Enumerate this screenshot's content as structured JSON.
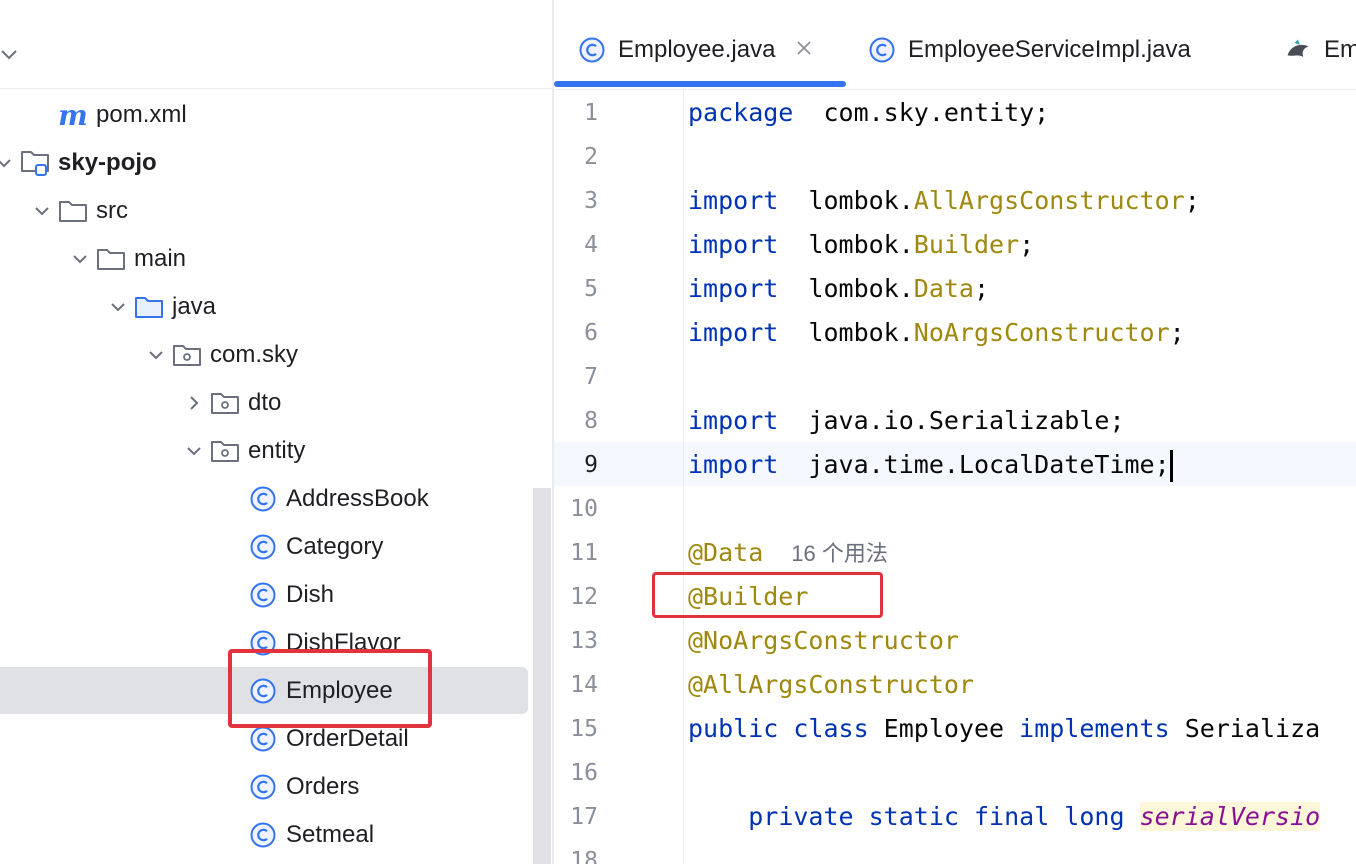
{
  "project_tree": {
    "nodes": [
      {
        "label": "pom.xml",
        "icon": "maven-m-icon",
        "arrow": "none"
      },
      {
        "label": "sky-pojo",
        "icon": "module-folder-icon",
        "arrow": "expanded"
      },
      {
        "label": "src",
        "icon": "folder-icon",
        "arrow": "expanded"
      },
      {
        "label": "main",
        "icon": "folder-icon",
        "arrow": "expanded"
      },
      {
        "label": "java",
        "icon": "source-folder-icon",
        "arrow": "expanded"
      },
      {
        "label": "com.sky",
        "icon": "package-icon",
        "arrow": "expanded"
      },
      {
        "label": "dto",
        "icon": "package-icon",
        "arrow": "collapsed"
      },
      {
        "label": "entity",
        "icon": "package-icon",
        "arrow": "expanded"
      },
      {
        "label": "AddressBook",
        "icon": "class-icon",
        "arrow": "none"
      },
      {
        "label": "Category",
        "icon": "class-icon",
        "arrow": "none"
      },
      {
        "label": "Dish",
        "icon": "class-icon",
        "arrow": "none"
      },
      {
        "label": "DishFlavor",
        "icon": "class-icon",
        "arrow": "none"
      },
      {
        "label": "Employee",
        "icon": "class-icon",
        "arrow": "none",
        "selected": true
      },
      {
        "label": "OrderDetail",
        "icon": "class-icon",
        "arrow": "none"
      },
      {
        "label": "Orders",
        "icon": "class-icon",
        "arrow": "none"
      },
      {
        "label": "Setmeal",
        "icon": "class-icon",
        "arrow": "none"
      }
    ]
  },
  "tabs": [
    {
      "label": "Employee.java",
      "icon": "class-icon",
      "active": true,
      "closable": true
    },
    {
      "label": "EmployeeServiceImpl.java",
      "icon": "class-icon",
      "active": false
    },
    {
      "label": "Em",
      "icon": "bird-icon",
      "active": false
    }
  ],
  "editor": {
    "current_line": 9,
    "lines": [
      {
        "n": "1",
        "parts": [
          [
            "kw",
            "package"
          ],
          [
            "",
            "  com.sky.entity;"
          ]
        ]
      },
      {
        "n": "2",
        "parts": []
      },
      {
        "n": "3",
        "parts": [
          [
            "kw",
            "import"
          ],
          [
            "",
            "  lombok."
          ],
          [
            "tp",
            "AllArgsConstructor"
          ],
          [
            "",
            ";"
          ]
        ]
      },
      {
        "n": "4",
        "parts": [
          [
            "kw",
            "import"
          ],
          [
            "",
            "  lombok."
          ],
          [
            "tp",
            "Builder"
          ],
          [
            "",
            ";"
          ]
        ]
      },
      {
        "n": "5",
        "parts": [
          [
            "kw",
            "import"
          ],
          [
            "",
            "  lombok."
          ],
          [
            "tp",
            "Data"
          ],
          [
            "",
            ";"
          ]
        ]
      },
      {
        "n": "6",
        "parts": [
          [
            "kw",
            "import"
          ],
          [
            "",
            "  lombok."
          ],
          [
            "tp",
            "NoArgsConstructor"
          ],
          [
            "",
            ";"
          ]
        ]
      },
      {
        "n": "7",
        "parts": []
      },
      {
        "n": "8",
        "parts": [
          [
            "kw",
            "import"
          ],
          [
            "",
            "  java.io.Serializable;"
          ]
        ]
      },
      {
        "n": "9",
        "parts": [
          [
            "kw",
            "import"
          ],
          [
            "",
            "  java.time.LocalDateTime;"
          ]
        ]
      },
      {
        "n": "10",
        "parts": []
      },
      {
        "n": "11",
        "parts": [
          [
            "ann",
            "@Data"
          ]
        ],
        "hint": "16 个用法"
      },
      {
        "n": "12",
        "parts": [
          [
            "ann",
            "@Builder"
          ]
        ]
      },
      {
        "n": "13",
        "parts": [
          [
            "ann",
            "@NoArgsConstructor"
          ]
        ]
      },
      {
        "n": "14",
        "parts": [
          [
            "ann",
            "@AllArgsConstructor"
          ]
        ]
      },
      {
        "n": "15",
        "parts": [
          [
            "kw",
            "public class"
          ],
          [
            "",
            " Employee "
          ],
          [
            "kw",
            "implements"
          ],
          [
            "",
            " Serializa"
          ]
        ]
      },
      {
        "n": "16",
        "parts": []
      },
      {
        "n": "17",
        "parts": [
          [
            "",
            "    "
          ],
          [
            "kw",
            "private static final long"
          ],
          [
            "",
            " "
          ],
          [
            "field",
            "serialVersio"
          ]
        ]
      },
      {
        "n": "18",
        "parts": []
      }
    ]
  },
  "colors": {
    "accent": "#3574f0",
    "highlight_box": "#e0333d",
    "keyword": "#0033b3",
    "annotation": "#9e880d"
  }
}
